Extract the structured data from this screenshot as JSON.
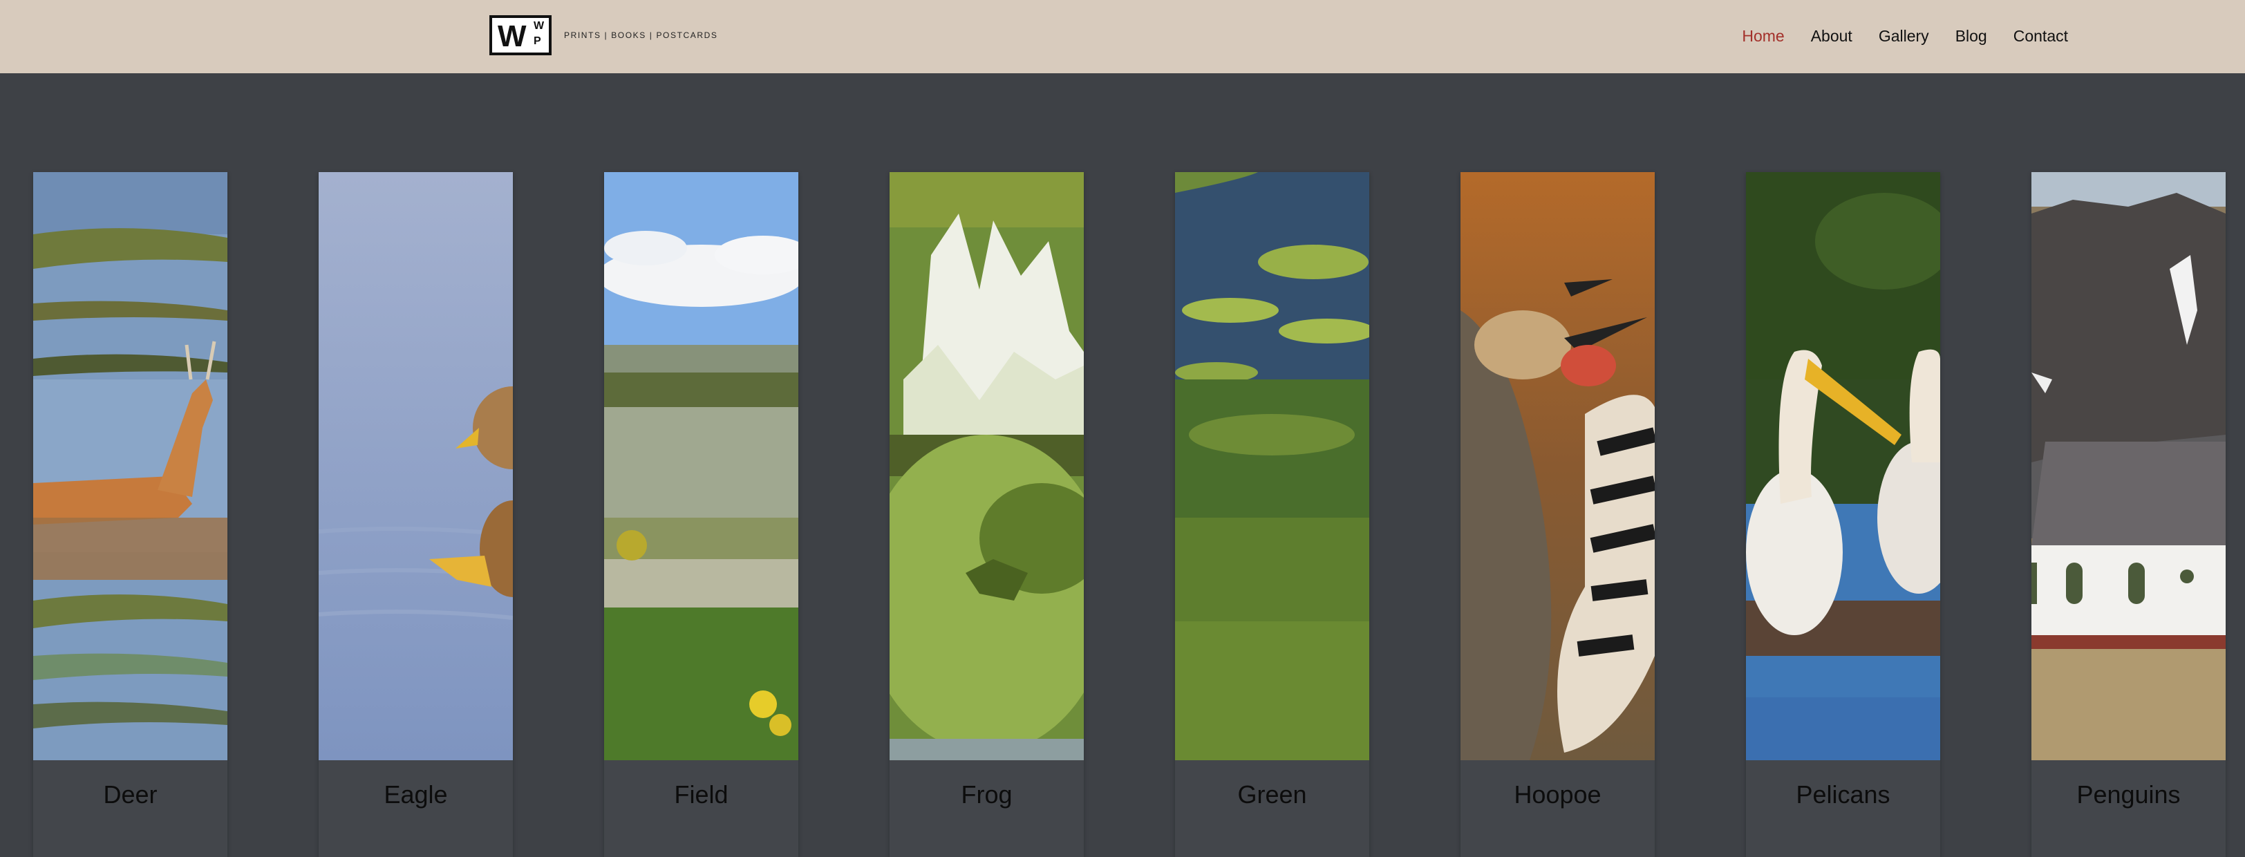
{
  "header": {
    "logo": {
      "letter_big": "W",
      "letter_top": "W",
      "letter_bottom": "P",
      "tagline": "PRINTS | BOOKS | POSTCARDS"
    },
    "nav": [
      {
        "label": "Home",
        "active": true
      },
      {
        "label": "About",
        "active": false
      },
      {
        "label": "Gallery",
        "active": false
      },
      {
        "label": "Blog",
        "active": false
      },
      {
        "label": "Contact",
        "active": false
      }
    ]
  },
  "gallery": {
    "items": [
      {
        "caption": "Deer"
      },
      {
        "caption": "Eagle"
      },
      {
        "caption": "Field"
      },
      {
        "caption": "Frog"
      },
      {
        "caption": "Green"
      },
      {
        "caption": "Hoopoe"
      },
      {
        "caption": "Pelicans"
      },
      {
        "caption": "Penguins"
      }
    ]
  },
  "colors": {
    "header_bg": "#d8cbbd",
    "page_bg": "#3e4146",
    "card_bg": "#43464b",
    "nav_active": "#a3302a"
  }
}
